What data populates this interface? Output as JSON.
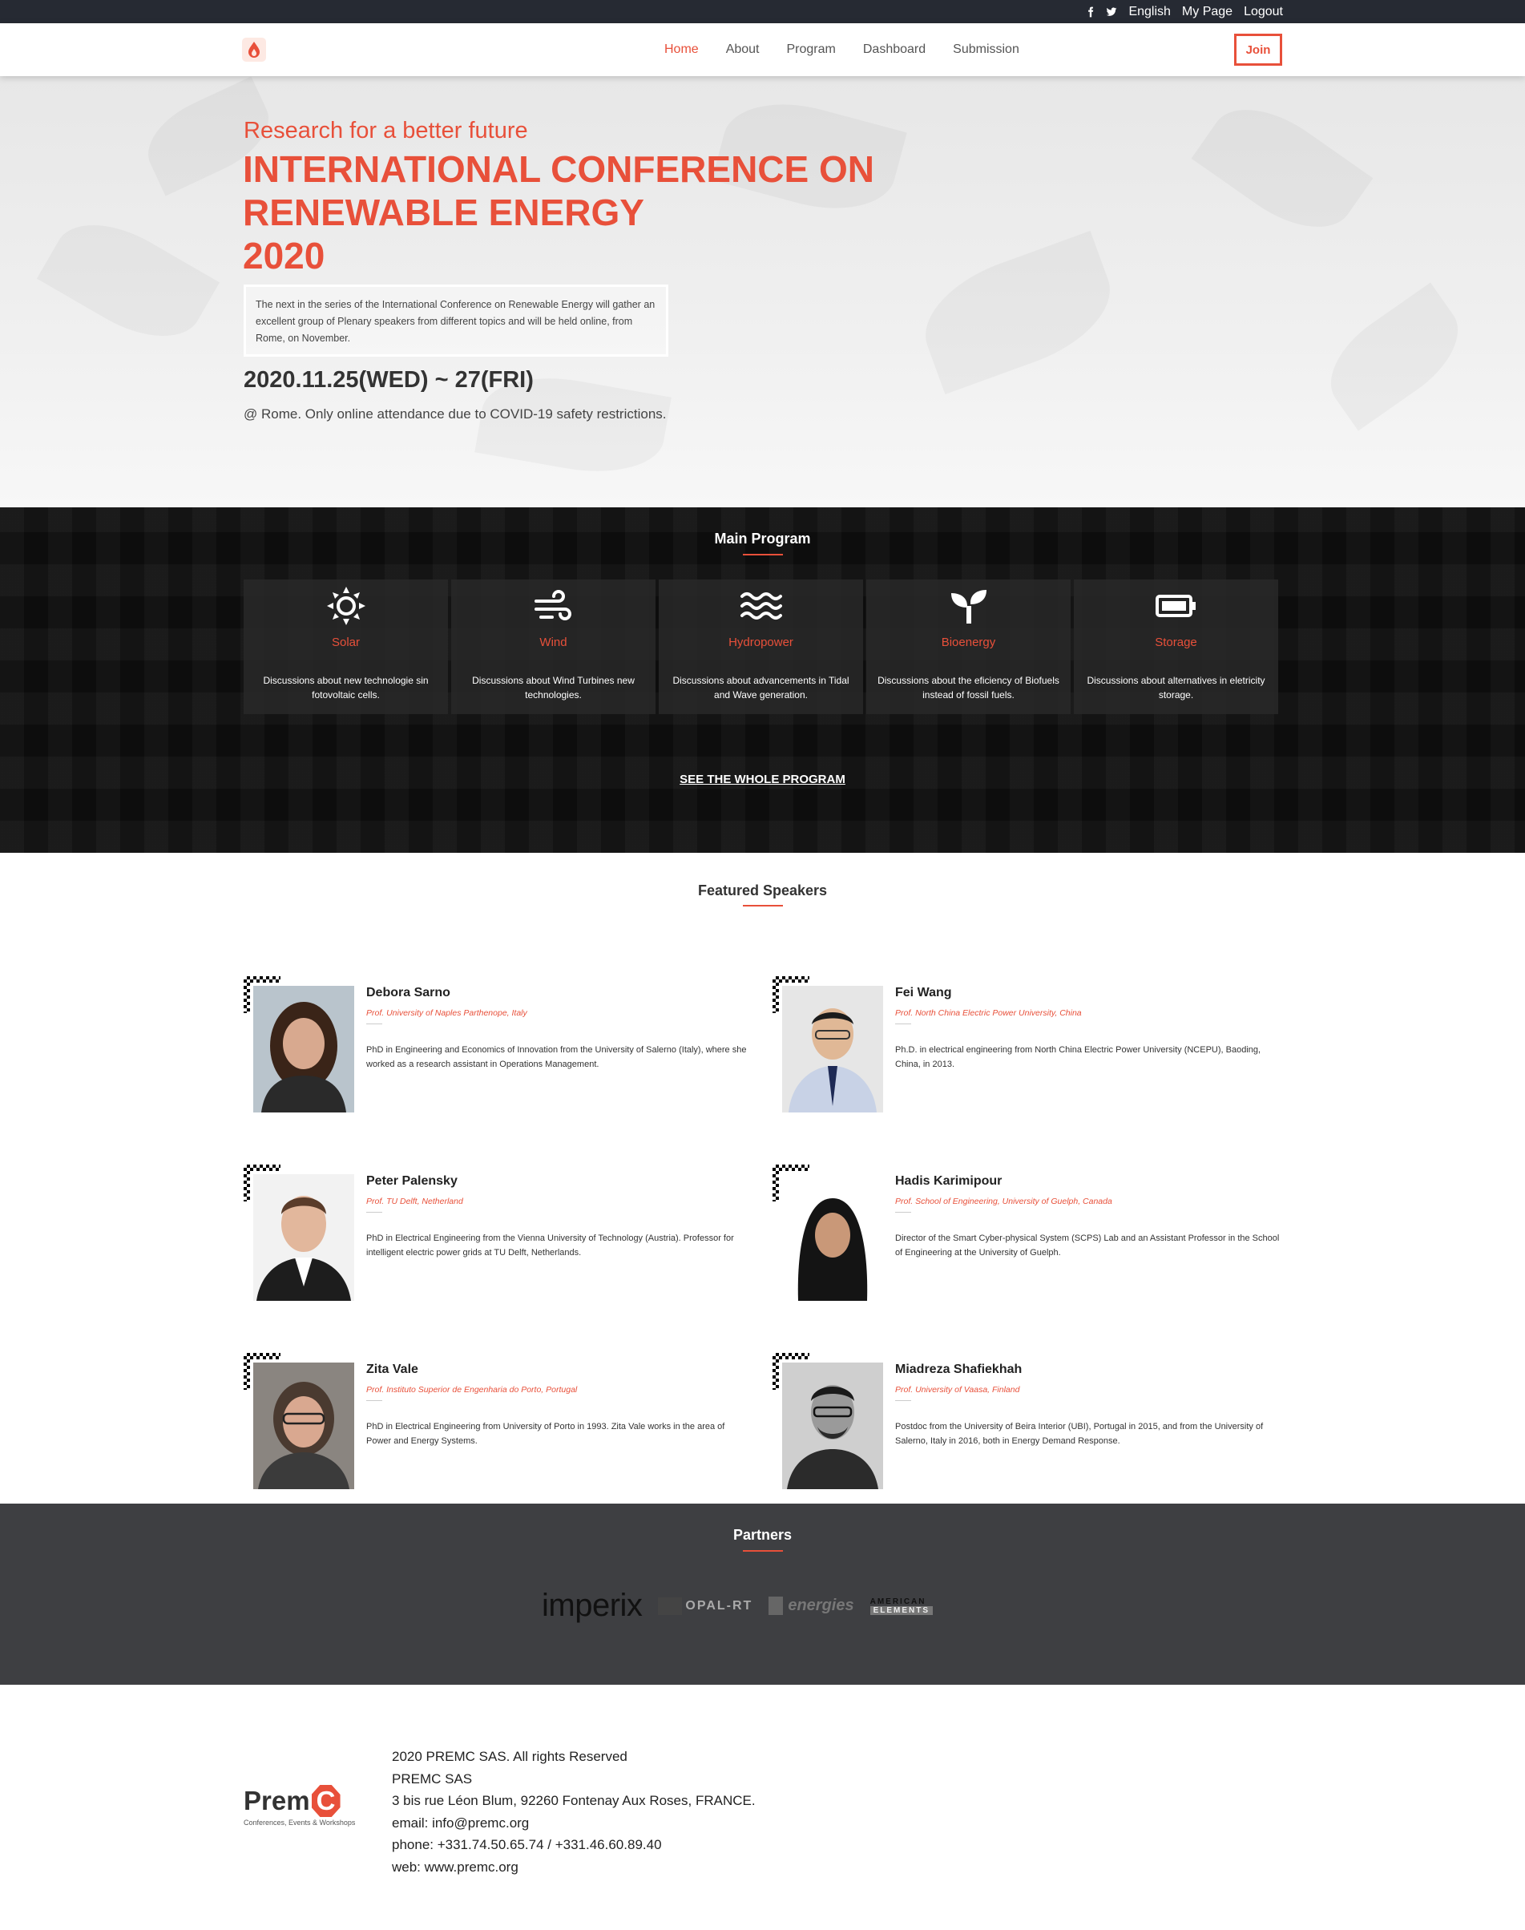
{
  "topbar": {
    "social": [
      "facebook-icon",
      "twitter-icon"
    ],
    "language": "English",
    "my_page": "My Page",
    "logout": "Logout"
  },
  "nav": {
    "items": [
      "Home",
      "About",
      "Program",
      "Dashboard",
      "Submission"
    ],
    "active": "Home",
    "join": "Join"
  },
  "hero": {
    "tagline": "Research for a better future",
    "title_lines": [
      "INTERNATIONAL CONFERENCE ON",
      "RENEWABLE ENERGY",
      "2020"
    ],
    "description": "The next in the series of the International Conference on Renewable Energy will gather an excellent group of Plenary speakers from different topics and will be held online, from Rome, on November.",
    "dates": "2020.11.25(WED) ~ 27(FRI)",
    "location_note": "@ Rome. Only online attendance due to COVID-19 safety restrictions."
  },
  "program": {
    "title": "Main Program",
    "cards": [
      {
        "icon": "sun-icon",
        "title": "Solar",
        "desc": "Discussions about new technologie sin fotovoltaic cells."
      },
      {
        "icon": "wind-icon",
        "title": "Wind",
        "desc": "Discussions about Wind Turbines new technologies."
      },
      {
        "icon": "waves-icon",
        "title": "Hydropower",
        "desc": "Discussions about advancements in Tidal and Wave generation."
      },
      {
        "icon": "sprout-icon",
        "title": "Bioenergy",
        "desc": "Discussions about the eficiency of Biofuels instead of fossil fuels."
      },
      {
        "icon": "battery-icon",
        "title": "Storage",
        "desc": "Discussions about alternatives in eletricity storage."
      }
    ],
    "see_all": "SEE THE WHOLE PROGRAM"
  },
  "speakers": {
    "title": "Featured Speakers",
    "items": [
      {
        "name": "Debora Sarno",
        "affiliation": "Prof. University of Naples Parthenope, Italy",
        "bio": "PhD in Engineering and Economics of Innovation from the University of Salerno (Italy), where she worked as a research assistant in Operations Management."
      },
      {
        "name": "Fei Wang",
        "affiliation": "Prof. North China Electric Power University, China",
        "bio": "Ph.D. in electrical engineering from North China Electric Power University (NCEPU), Baoding, China, in 2013."
      },
      {
        "name": "Peter Palensky",
        "affiliation": "Prof. TU Delft, Netherland",
        "bio": "PhD in Electrical Engineering from the Vienna University of Technology (Austria). Professor for intelligent electric power grids at TU Delft, Netherlands."
      },
      {
        "name": "Hadis Karimipour",
        "affiliation": "Prof. School of Engineering, University of Guelph, Canada",
        "bio": "Director of the Smart Cyber-physical System (SCPS) Lab and an Assistant Professor in the School of Engineering at the University of Guelph."
      },
      {
        "name": "Zita Vale",
        "affiliation": "Prof. Instituto Superior de Engenharia do Porto, Portugal",
        "bio": "PhD in Electrical Engineering from University of Porto in 1993. Zita Vale works in the area of Power and Energy Systems."
      },
      {
        "name": "Miadreza Shafiekhah",
        "affiliation": "Prof. University of Vaasa, Finland",
        "bio": "Postdoc from the University of Beira Interior (UBI), Portugal in 2015, and from the University of Salerno, Italy in 2016, both in Energy Demand Response."
      }
    ]
  },
  "partners": {
    "title": "Partners",
    "logos": [
      "imperix",
      "OPAL-RT",
      "energies",
      "AMERICAN",
      "ELEMENTS"
    ]
  },
  "footer": {
    "brand": "Prem",
    "brand_c": "C",
    "brand_sub": "Conferences, Events & Workshops",
    "lines": [
      "2020 PREMC SAS. All rights Reserved",
      "PREMC SAS",
      "3 bis rue Léon Blum, 92260 Fontenay Aux Roses, FRANCE.",
      "email: info@premc.org",
      "phone: +331.74.50.65.74 / +331.46.60.89.40",
      "web: www.premc.org"
    ]
  },
  "colors": {
    "accent": "#e8503a",
    "topbar": "#262a33",
    "partners_bg": "#3e3f42"
  }
}
